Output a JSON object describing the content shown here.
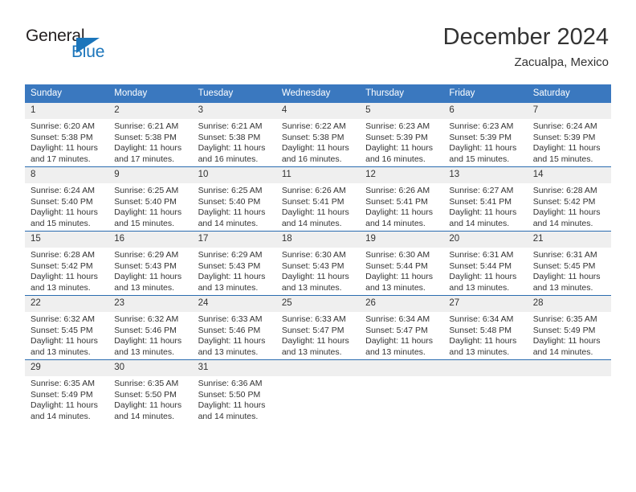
{
  "logo": {
    "word_top": "General",
    "word_bottom": "Blue",
    "icon": "triangle-icon",
    "color_dark": "#231f20",
    "color_blue": "#1b75bb"
  },
  "header": {
    "title": "December 2024",
    "location": "Zacualpa, Mexico"
  },
  "theme": {
    "header_blue": "#3a78bf",
    "grid_line_blue": "#2b6cb0",
    "daynum_band": "#efefef",
    "text": "#333333"
  },
  "weekdays": [
    "Sunday",
    "Monday",
    "Tuesday",
    "Wednesday",
    "Thursday",
    "Friday",
    "Saturday"
  ],
  "weeks": [
    [
      {
        "day": "1",
        "sunrise": "Sunrise: 6:20 AM",
        "sunset": "Sunset: 5:38 PM",
        "daylight1": "Daylight: 11 hours",
        "daylight2": "and 17 minutes."
      },
      {
        "day": "2",
        "sunrise": "Sunrise: 6:21 AM",
        "sunset": "Sunset: 5:38 PM",
        "daylight1": "Daylight: 11 hours",
        "daylight2": "and 17 minutes."
      },
      {
        "day": "3",
        "sunrise": "Sunrise: 6:21 AM",
        "sunset": "Sunset: 5:38 PM",
        "daylight1": "Daylight: 11 hours",
        "daylight2": "and 16 minutes."
      },
      {
        "day": "4",
        "sunrise": "Sunrise: 6:22 AM",
        "sunset": "Sunset: 5:38 PM",
        "daylight1": "Daylight: 11 hours",
        "daylight2": "and 16 minutes."
      },
      {
        "day": "5",
        "sunrise": "Sunrise: 6:23 AM",
        "sunset": "Sunset: 5:39 PM",
        "daylight1": "Daylight: 11 hours",
        "daylight2": "and 16 minutes."
      },
      {
        "day": "6",
        "sunrise": "Sunrise: 6:23 AM",
        "sunset": "Sunset: 5:39 PM",
        "daylight1": "Daylight: 11 hours",
        "daylight2": "and 15 minutes."
      },
      {
        "day": "7",
        "sunrise": "Sunrise: 6:24 AM",
        "sunset": "Sunset: 5:39 PM",
        "daylight1": "Daylight: 11 hours",
        "daylight2": "and 15 minutes."
      }
    ],
    [
      {
        "day": "8",
        "sunrise": "Sunrise: 6:24 AM",
        "sunset": "Sunset: 5:40 PM",
        "daylight1": "Daylight: 11 hours",
        "daylight2": "and 15 minutes."
      },
      {
        "day": "9",
        "sunrise": "Sunrise: 6:25 AM",
        "sunset": "Sunset: 5:40 PM",
        "daylight1": "Daylight: 11 hours",
        "daylight2": "and 15 minutes."
      },
      {
        "day": "10",
        "sunrise": "Sunrise: 6:25 AM",
        "sunset": "Sunset: 5:40 PM",
        "daylight1": "Daylight: 11 hours",
        "daylight2": "and 14 minutes."
      },
      {
        "day": "11",
        "sunrise": "Sunrise: 6:26 AM",
        "sunset": "Sunset: 5:41 PM",
        "daylight1": "Daylight: 11 hours",
        "daylight2": "and 14 minutes."
      },
      {
        "day": "12",
        "sunrise": "Sunrise: 6:26 AM",
        "sunset": "Sunset: 5:41 PM",
        "daylight1": "Daylight: 11 hours",
        "daylight2": "and 14 minutes."
      },
      {
        "day": "13",
        "sunrise": "Sunrise: 6:27 AM",
        "sunset": "Sunset: 5:41 PM",
        "daylight1": "Daylight: 11 hours",
        "daylight2": "and 14 minutes."
      },
      {
        "day": "14",
        "sunrise": "Sunrise: 6:28 AM",
        "sunset": "Sunset: 5:42 PM",
        "daylight1": "Daylight: 11 hours",
        "daylight2": "and 14 minutes."
      }
    ],
    [
      {
        "day": "15",
        "sunrise": "Sunrise: 6:28 AM",
        "sunset": "Sunset: 5:42 PM",
        "daylight1": "Daylight: 11 hours",
        "daylight2": "and 13 minutes."
      },
      {
        "day": "16",
        "sunrise": "Sunrise: 6:29 AM",
        "sunset": "Sunset: 5:43 PM",
        "daylight1": "Daylight: 11 hours",
        "daylight2": "and 13 minutes."
      },
      {
        "day": "17",
        "sunrise": "Sunrise: 6:29 AM",
        "sunset": "Sunset: 5:43 PM",
        "daylight1": "Daylight: 11 hours",
        "daylight2": "and 13 minutes."
      },
      {
        "day": "18",
        "sunrise": "Sunrise: 6:30 AM",
        "sunset": "Sunset: 5:43 PM",
        "daylight1": "Daylight: 11 hours",
        "daylight2": "and 13 minutes."
      },
      {
        "day": "19",
        "sunrise": "Sunrise: 6:30 AM",
        "sunset": "Sunset: 5:44 PM",
        "daylight1": "Daylight: 11 hours",
        "daylight2": "and 13 minutes."
      },
      {
        "day": "20",
        "sunrise": "Sunrise: 6:31 AM",
        "sunset": "Sunset: 5:44 PM",
        "daylight1": "Daylight: 11 hours",
        "daylight2": "and 13 minutes."
      },
      {
        "day": "21",
        "sunrise": "Sunrise: 6:31 AM",
        "sunset": "Sunset: 5:45 PM",
        "daylight1": "Daylight: 11 hours",
        "daylight2": "and 13 minutes."
      }
    ],
    [
      {
        "day": "22",
        "sunrise": "Sunrise: 6:32 AM",
        "sunset": "Sunset: 5:45 PM",
        "daylight1": "Daylight: 11 hours",
        "daylight2": "and 13 minutes."
      },
      {
        "day": "23",
        "sunrise": "Sunrise: 6:32 AM",
        "sunset": "Sunset: 5:46 PM",
        "daylight1": "Daylight: 11 hours",
        "daylight2": "and 13 minutes."
      },
      {
        "day": "24",
        "sunrise": "Sunrise: 6:33 AM",
        "sunset": "Sunset: 5:46 PM",
        "daylight1": "Daylight: 11 hours",
        "daylight2": "and 13 minutes."
      },
      {
        "day": "25",
        "sunrise": "Sunrise: 6:33 AM",
        "sunset": "Sunset: 5:47 PM",
        "daylight1": "Daylight: 11 hours",
        "daylight2": "and 13 minutes."
      },
      {
        "day": "26",
        "sunrise": "Sunrise: 6:34 AM",
        "sunset": "Sunset: 5:47 PM",
        "daylight1": "Daylight: 11 hours",
        "daylight2": "and 13 minutes."
      },
      {
        "day": "27",
        "sunrise": "Sunrise: 6:34 AM",
        "sunset": "Sunset: 5:48 PM",
        "daylight1": "Daylight: 11 hours",
        "daylight2": "and 13 minutes."
      },
      {
        "day": "28",
        "sunrise": "Sunrise: 6:35 AM",
        "sunset": "Sunset: 5:49 PM",
        "daylight1": "Daylight: 11 hours",
        "daylight2": "and 14 minutes."
      }
    ],
    [
      {
        "day": "29",
        "sunrise": "Sunrise: 6:35 AM",
        "sunset": "Sunset: 5:49 PM",
        "daylight1": "Daylight: 11 hours",
        "daylight2": "and 14 minutes."
      },
      {
        "day": "30",
        "sunrise": "Sunrise: 6:35 AM",
        "sunset": "Sunset: 5:50 PM",
        "daylight1": "Daylight: 11 hours",
        "daylight2": "and 14 minutes."
      },
      {
        "day": "31",
        "sunrise": "Sunrise: 6:36 AM",
        "sunset": "Sunset: 5:50 PM",
        "daylight1": "Daylight: 11 hours",
        "daylight2": "and 14 minutes."
      },
      {
        "day": "",
        "sunrise": "",
        "sunset": "",
        "daylight1": "",
        "daylight2": ""
      },
      {
        "day": "",
        "sunrise": "",
        "sunset": "",
        "daylight1": "",
        "daylight2": ""
      },
      {
        "day": "",
        "sunrise": "",
        "sunset": "",
        "daylight1": "",
        "daylight2": ""
      },
      {
        "day": "",
        "sunrise": "",
        "sunset": "",
        "daylight1": "",
        "daylight2": ""
      }
    ]
  ]
}
